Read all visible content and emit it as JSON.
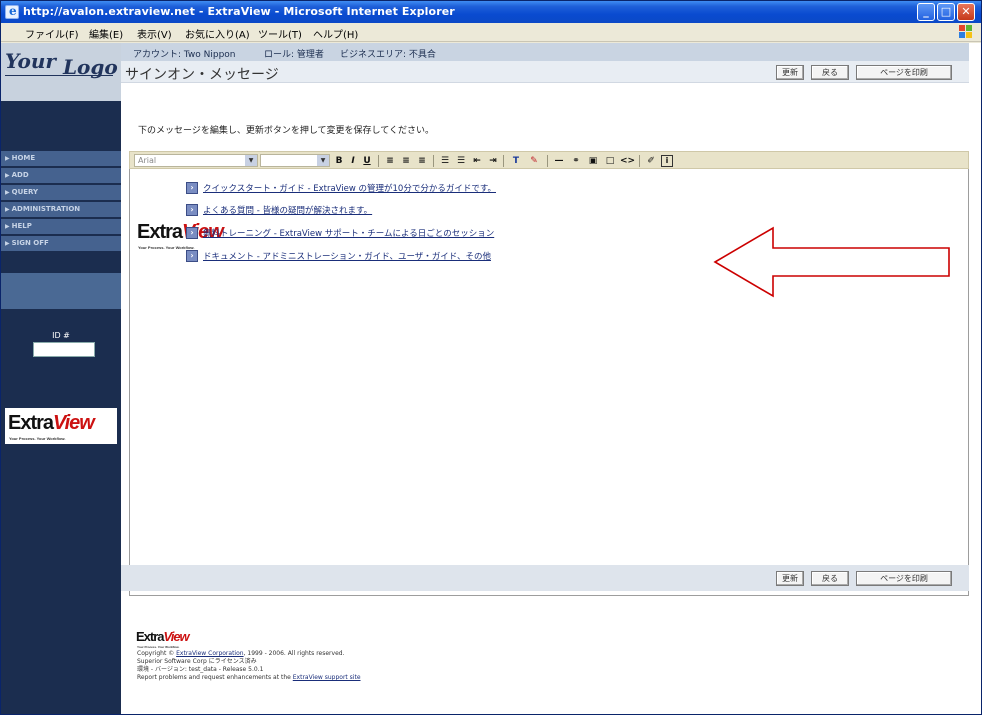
{
  "window": {
    "title": "http://avalon.extraview.net - ExtraView - Microsoft Internet Explorer",
    "controls": {
      "minimize": "_",
      "maximize": "□",
      "close": "✕"
    }
  },
  "menubar": {
    "items": [
      "ファイル(F)",
      "編集(E)",
      "表示(V)",
      "お気に入り(A)",
      "ツール(T)",
      "ヘルプ(H)"
    ]
  },
  "sidebar": {
    "logo_your": "Your",
    "logo_logo": "Logo",
    "nav": [
      {
        "label": "HOME",
        "icon": "arrow-right-icon"
      },
      {
        "label": "ADD",
        "icon": "arrow-right-icon"
      },
      {
        "label": "QUERY",
        "icon": "arrow-right-icon"
      },
      {
        "label": "ADMINISTRATION",
        "icon": "arrow-right-icon"
      },
      {
        "label": "HELP",
        "icon": "arrow-right-icon"
      },
      {
        "label": "SIGN OFF",
        "icon": "arrow-right-icon"
      }
    ],
    "id_label": "ID #",
    "id_value": ""
  },
  "header": {
    "account": "アカウント: Two Nippon",
    "role": "ロール: 管理者",
    "business_area": "ビジネスエリア: 不具合"
  },
  "page": {
    "title": "サインオン・メッセージ",
    "instruction": "下のメッセージを編集し、更新ボタンを押して変更を保存してください。"
  },
  "buttons": {
    "update": "更新",
    "back": "戻る",
    "print": "ページを印刷"
  },
  "editor": {
    "font_name": "Arial",
    "font_size": "",
    "links": [
      "クイックスタート・ガイド - ExtraView の管理が10分で分かるガイドです。",
      "よくある質問 - 皆様の疑問が解決されます。",
      "無料トレーニング - ExtraView サポート・チームによる日ごとのセッション",
      "ドキュメント - アドミニストレーション・ガイド、ユーザ・ガイド、その他"
    ],
    "logo_extra": "Extra",
    "logo_view": "View",
    "logo_tagline": "Your Process. Your Workflow."
  },
  "footer": {
    "logo_extra": "Extra",
    "logo_view": "View",
    "logo_tagline": "Your Process. Your Workflow.",
    "copyright_prefix": "Copyright © ",
    "copyright_link": "ExtraView Corporation",
    "copyright_suffix": ", 1999 - 2006.  All rights reserved.",
    "license": "Superior Software Corp にライセンス済み",
    "version": "環境 - バージョン: test_data - Release 5.0.1",
    "report_prefix": "Report problems and request enhancements at the ",
    "report_link": "ExtraView support site"
  },
  "colors": {
    "sidebar_bg": "#1b2d4f",
    "header_bg": "#c9d4e2",
    "toolbar_bg": "#e8e3c9",
    "annotation_arrow": "#cc0000",
    "brand_red": "#cc1111"
  }
}
